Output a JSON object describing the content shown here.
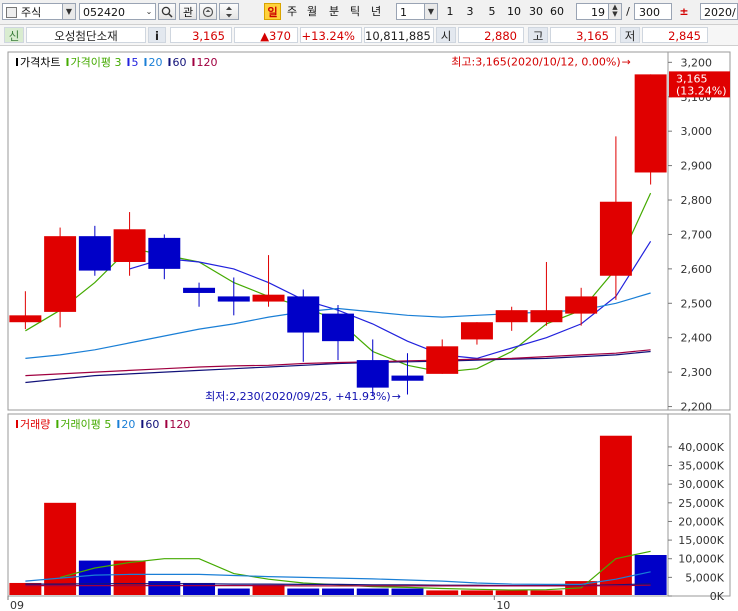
{
  "toolbar": {
    "market": "주식",
    "code": "052420",
    "search_icon": "magnifier-icon",
    "watch_label": "관",
    "icon_recent": "recent-icon",
    "icon_updown": "updown-arrows-icon",
    "period_day": "일",
    "period_week": "주",
    "period_month": "월",
    "period_minute": "분",
    "period_tick": "틱",
    "period_year": "년",
    "interval_value": "1",
    "quick_1": "1",
    "quick_3": "3",
    "quick_5": "5",
    "quick_10": "10",
    "quick_30": "30",
    "quick_60": "60",
    "visible_count": "19",
    "slash": "/",
    "total_count": "300",
    "date_value": "2020/"
  },
  "info": {
    "tag": "신",
    "name": "오성첨단소재",
    "info_icon": "i",
    "price": "3,165",
    "change": "▲370",
    "change_pct": "+13.24%",
    "volume": "10,811,885",
    "open_label": "시",
    "open": "2,880",
    "high_label": "고",
    "high": "3,165",
    "low_label": "저",
    "low": "2,845"
  },
  "colors": {
    "up": "#e00000",
    "down": "#0000c8",
    "ma3": "#44aa00",
    "ma5": "#2222dd",
    "ma20": "#1a7fd6",
    "ma60": "#12127a",
    "ma120": "#a00040"
  },
  "chart_data": [
    {
      "type": "candlestick",
      "legend": [
        {
          "text": "가격차트",
          "color": "#000000"
        },
        {
          "text": "가격이평 3",
          "color": "#44aa00"
        },
        {
          "text": "5",
          "color": "#2222dd"
        },
        {
          "text": "20",
          "color": "#1a7fd6"
        },
        {
          "text": "60",
          "color": "#12127a"
        },
        {
          "text": "120",
          "color": "#a00040"
        }
      ],
      "y_ticks": [
        "3,200",
        "3,100",
        "3,000",
        "2,900",
        "2,800",
        "2,700",
        "2,600",
        "2,500",
        "2,400",
        "2,300",
        "2,200"
      ],
      "y_tick_values": [
        3200,
        3100,
        3000,
        2900,
        2800,
        2700,
        2600,
        2500,
        2400,
        2300,
        2200
      ],
      "ylim": [
        2190,
        3230
      ],
      "x_labels": [
        {
          "text": "09",
          "index": 0
        },
        {
          "text": "10",
          "index": 14
        }
      ],
      "candles": [
        {
          "o": 2445,
          "h": 2535,
          "l": 2425,
          "c": 2465
        },
        {
          "o": 2475,
          "h": 2720,
          "l": 2430,
          "c": 2695
        },
        {
          "o": 2695,
          "h": 2725,
          "l": 2580,
          "c": 2595
        },
        {
          "o": 2620,
          "h": 2765,
          "l": 2580,
          "c": 2715
        },
        {
          "o": 2690,
          "h": 2700,
          "l": 2570,
          "c": 2600
        },
        {
          "o": 2545,
          "h": 2560,
          "l": 2490,
          "c": 2530
        },
        {
          "o": 2520,
          "h": 2575,
          "l": 2465,
          "c": 2505
        },
        {
          "o": 2505,
          "h": 2640,
          "l": 2490,
          "c": 2525
        },
        {
          "o": 2520,
          "h": 2540,
          "l": 2330,
          "c": 2415
        },
        {
          "o": 2470,
          "h": 2495,
          "l": 2335,
          "c": 2390
        },
        {
          "o": 2335,
          "h": 2395,
          "l": 2230,
          "c": 2255
        },
        {
          "o": 2290,
          "h": 2355,
          "l": 2235,
          "c": 2275
        },
        {
          "o": 2295,
          "h": 2395,
          "l": 2295,
          "c": 2375
        },
        {
          "o": 2395,
          "h": 2445,
          "l": 2380,
          "c": 2445
        },
        {
          "o": 2445,
          "h": 2490,
          "l": 2420,
          "c": 2480
        },
        {
          "o": 2445,
          "h": 2620,
          "l": 2435,
          "c": 2480
        },
        {
          "o": 2470,
          "h": 2545,
          "l": 2435,
          "c": 2520
        },
        {
          "o": 2580,
          "h": 2985,
          "l": 2510,
          "c": 2795
        },
        {
          "o": 2880,
          "h": 3165,
          "l": 2845,
          "c": 3165
        }
      ],
      "ma": [
        {
          "name": "3",
          "color": "#44aa00",
          "values": [
            2420,
            2480,
            2560,
            2660,
            2640,
            2620,
            2560,
            2520,
            2490,
            2450,
            2360,
            2320,
            2300,
            2310,
            2360,
            2440,
            2480,
            2600,
            2820
          ]
        },
        {
          "name": "5",
          "color": "#2222dd",
          "values": [
            null,
            null,
            null,
            2600,
            2630,
            2620,
            2600,
            2560,
            2510,
            2480,
            2440,
            2390,
            2350,
            2340,
            2370,
            2400,
            2440,
            2520,
            2680
          ]
        },
        {
          "name": "20",
          "color": "#1a7fd6",
          "values": [
            2340,
            2350,
            2365,
            2385,
            2405,
            2425,
            2440,
            2460,
            2475,
            2485,
            2475,
            2465,
            2460,
            2465,
            2470,
            2475,
            2480,
            2500,
            2530
          ]
        },
        {
          "name": "60",
          "color": "#12127a",
          "values": [
            2270,
            2280,
            2290,
            2295,
            2300,
            2305,
            2310,
            2315,
            2320,
            2325,
            2328,
            2330,
            2332,
            2335,
            2338,
            2340,
            2345,
            2350,
            2360
          ]
        },
        {
          "name": "120",
          "color": "#a00040",
          "values": [
            2290,
            2295,
            2300,
            2305,
            2310,
            2315,
            2318,
            2320,
            2325,
            2328,
            2330,
            2333,
            2335,
            2338,
            2340,
            2345,
            2350,
            2355,
            2365
          ]
        }
      ],
      "annotations": {
        "high": {
          "text": "최고:3,165(2020/10/12, 0.00%)",
          "arrow": "→",
          "index": 18,
          "value": 3165
        },
        "low": {
          "text": "최저:2,230(2020/09/25, +41.93%)",
          "arrow": "→",
          "index": 10,
          "value": 2230
        }
      },
      "current_price_label": [
        "3,165",
        "(13.24%)"
      ]
    },
    {
      "type": "bar",
      "legend": [
        {
          "text": "거래량",
          "color": "#e00000"
        },
        {
          "text": "거래이평 5",
          "color": "#44aa00"
        },
        {
          "text": "20",
          "color": "#1a7fd6"
        },
        {
          "text": "60",
          "color": "#12127a"
        },
        {
          "text": "120",
          "color": "#a00040"
        }
      ],
      "y_ticks": [
        "40,000K",
        "35,000K",
        "30,000K",
        "25,000K",
        "20,000K",
        "15,000K",
        "10,000K",
        "5,000K",
        "0K"
      ],
      "y_tick_values": [
        40000,
        35000,
        30000,
        25000,
        20000,
        15000,
        10000,
        5000,
        0
      ],
      "ylim": [
        0,
        44000
      ],
      "unit": "K",
      "values": [
        3500,
        25000,
        9500,
        9500,
        4000,
        3500,
        2000,
        3000,
        2000,
        2000,
        2000,
        2000,
        1500,
        1500,
        1500,
        1500,
        4000,
        43000,
        11000
      ],
      "up": [
        true,
        true,
        false,
        true,
        false,
        false,
        false,
        true,
        false,
        false,
        false,
        false,
        true,
        true,
        true,
        true,
        true,
        true,
        false
      ],
      "ma": [
        {
          "name": "5",
          "color": "#44aa00",
          "values": [
            null,
            5000,
            7500,
            9000,
            10000,
            10000,
            6000,
            4500,
            3500,
            3000,
            2500,
            2300,
            2000,
            1800,
            1600,
            1700,
            2200,
            10000,
            12000
          ]
        },
        {
          "name": "20",
          "color": "#1a7fd6",
          "values": [
            4000,
            4800,
            5600,
            5800,
            5800,
            5800,
            5500,
            5200,
            5000,
            4800,
            4600,
            4300,
            4000,
            3500,
            3200,
            3100,
            3100,
            4500,
            6500
          ]
        },
        {
          "name": "60",
          "color": "#12127a",
          "values": [
            3200,
            3200,
            3300,
            3300,
            3300,
            3300,
            3200,
            3200,
            3100,
            3100,
            3000,
            3000,
            2900,
            2900,
            2800,
            2800,
            2800,
            3000,
            3300
          ]
        },
        {
          "name": "120",
          "color": "#a00040",
          "values": [
            2800,
            2800,
            2800,
            2800,
            2800,
            2800,
            2800,
            2800,
            2700,
            2700,
            2700,
            2700,
            2700,
            2700,
            2700,
            2700,
            2700,
            2800,
            2900
          ]
        }
      ]
    }
  ]
}
